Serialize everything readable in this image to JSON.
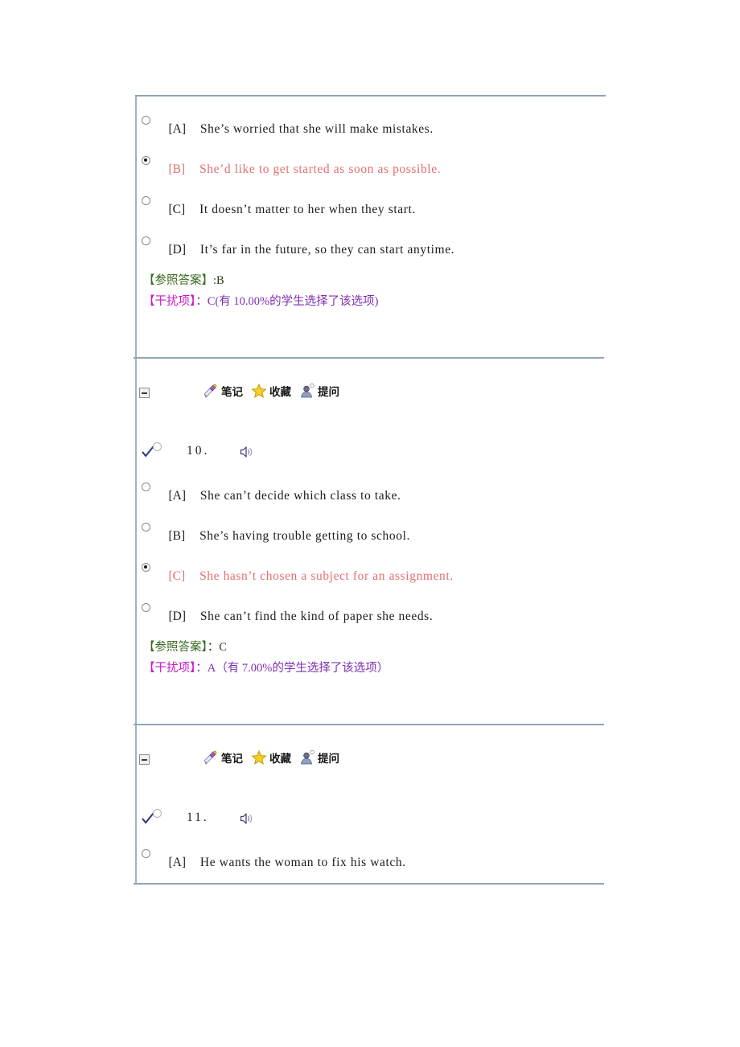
{
  "page": {
    "title": "听力题目解析",
    "colors": {
      "correct_option": "#e36f72",
      "answer_bracket": "#38691f",
      "answer_text": "#243c12",
      "distractor_bracket": "#c818c8",
      "distractor_text": "#7d2fb0",
      "rule": "#8fa3ba",
      "check": "#2d3a8c"
    }
  },
  "toolbar": {
    "collapse_label": "-",
    "items": [
      {
        "icon": "notebook-icon",
        "label": "笔记"
      },
      {
        "icon": "star-icon",
        "label": "收藏"
      },
      {
        "icon": "person-ask-icon",
        "label": "提问"
      }
    ]
  },
  "sections": [
    {
      "id": "q9-tail",
      "options": [
        {
          "tag": "[A]",
          "text": "She’s worried that she will make mistakes.",
          "selected": false,
          "correct": false
        },
        {
          "tag": "[B]",
          "text": "She’d like  to get  started as soon as possible.",
          "selected": true,
          "correct": true
        },
        {
          "tag": "[C]",
          "text": "It doesn’t matter to her  when they start.",
          "selected": false,
          "correct": false
        },
        {
          "tag": "[D]",
          "text": "It’s far in  the future, so  they  can start anytime.",
          "selected": false,
          "correct": false
        }
      ],
      "answer": {
        "bracket": "【参照答案】",
        "separator": ":",
        "value": "B"
      },
      "distractor": {
        "bracket": "【干扰项】",
        "separator": "：",
        "value": "C",
        "detail": "(有 10.00%的学生选择了该选项)"
      }
    },
    {
      "id": "q10",
      "question": {
        "number": "10.",
        "checked": true,
        "speaker": "speaker-icon"
      },
      "options": [
        {
          "tag": "[A]",
          "text": "She can’t decide which  class to take.",
          "selected": false,
          "correct": false
        },
        {
          "tag": "[B]",
          "text": "She’s having trouble  getting to school.",
          "selected": false,
          "correct": false
        },
        {
          "tag": "[C]",
          "text": "She hasn’t chosen  a subject for  an  assignment.",
          "selected": true,
          "correct": true
        },
        {
          "tag": "[D]",
          "text": "She can’t find the  kind of paper she  needs.",
          "selected": false,
          "correct": false
        }
      ],
      "answer": {
        "bracket": "【参照答案】",
        "separator": "：",
        "value": "C"
      },
      "distractor": {
        "bracket": "【干扰项】",
        "separator": "：",
        "value": "A",
        "detail": "（有 7.00%的学生选择了该选项）"
      }
    },
    {
      "id": "q11",
      "question": {
        "number": "11.",
        "checked": true,
        "speaker": "speaker-icon"
      },
      "options": [
        {
          "tag": "[A]",
          "text": "He wants the woman to  fix his watch.",
          "selected": false,
          "correct": false
        }
      ]
    }
  ]
}
